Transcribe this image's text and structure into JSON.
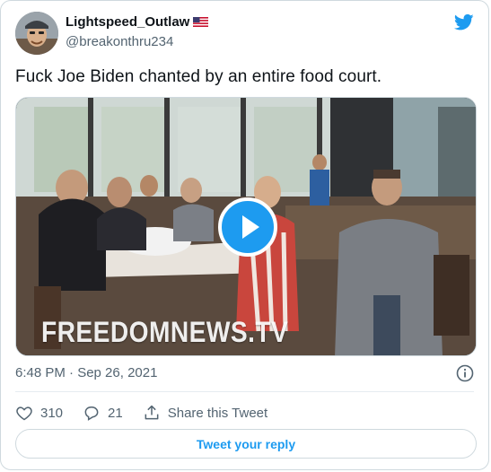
{
  "author": {
    "display_name": "Lightspeed_Outlaw",
    "handle": "@breakonthru234",
    "flag_icon": "us-flag-icon"
  },
  "tweet": {
    "text": "Fuck Joe Biden chanted by an entire food court.",
    "timestamp": "6:48 PM · Sep 26, 2021"
  },
  "media": {
    "watermark": "FREEDOMNEWS.TV",
    "play_icon": "play-icon"
  },
  "actions": {
    "like_count": "310",
    "reply_count": "21",
    "share_label": "Share this Tweet"
  },
  "reply_button_label": "Tweet your reply",
  "colors": {
    "accent": "#1d9bf0",
    "text_primary": "#0f1419",
    "text_secondary": "#536471",
    "border": "#cfd9de"
  }
}
